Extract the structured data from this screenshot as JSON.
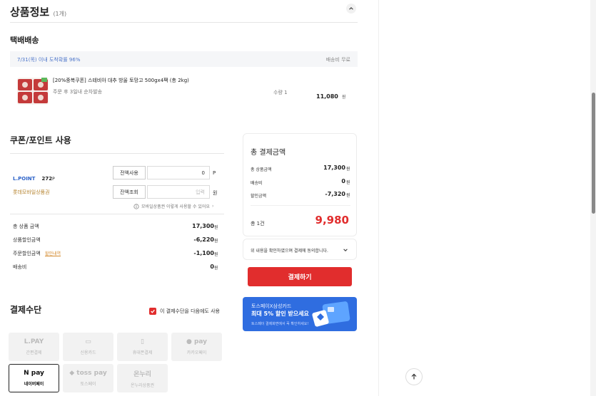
{
  "product_section": {
    "title": "상품정보",
    "count": "(1개)"
  },
  "delivery": {
    "title": "택배배송",
    "arrival": "7/31(목) 이내 도착확률 96%",
    "shipping_fee": "배송비 무료"
  },
  "product": {
    "name": "[20%중복쿠폰] 스테비아 대추 방울 토망고 500gx4팩 (총 2kg)",
    "note": "주문 후 3일내 순차발송",
    "qty": "수량 1",
    "price": "11,080",
    "unit": "원"
  },
  "coupon_section": {
    "title": "쿠폰/포인트 사용",
    "lpoint_brand": "L.POINT",
    "lpoint_value": "272",
    "lpoint_unit": "P",
    "lpoint_button": "전액사용",
    "lpoint_input_value": "0",
    "lpoint_input_unit": "P",
    "voucher_label": "롯데모바일상품권",
    "voucher_button": "잔액조회",
    "voucher_input_placeholder": "입력",
    "voucher_input_unit": "원",
    "notice": "모바일상품권 이렇게 사용할 수 있어요"
  },
  "left_totals": {
    "rows": [
      {
        "label": "총 상품 금액",
        "value": "17,300",
        "unit": "원"
      },
      {
        "label": "상품할인금액",
        "value": "-6,220",
        "unit": "원"
      },
      {
        "label": "주문할인금액",
        "value": "-1,100",
        "unit": "원"
      },
      {
        "label": "배송비",
        "value": "0",
        "unit": "원"
      }
    ],
    "detail_link": "할인내역"
  },
  "payment_method": {
    "title": "결제수단",
    "remember_label": "이 결제수단을 다음에도 사용",
    "tiles": [
      {
        "brand": "L.PAY",
        "name": "간편결제"
      },
      {
        "brand": "▭",
        "name": "신용카드"
      },
      {
        "brand": "▯",
        "name": "휴대폰결제"
      },
      {
        "brand": "● pay",
        "name": "카카오페이"
      },
      {
        "brand": "N pay",
        "name": "네이버페이"
      },
      {
        "brand": "◆ toss pay",
        "name": "토스페이"
      },
      {
        "brand": "온누리",
        "name": "온누리상품권"
      }
    ]
  },
  "summary": {
    "title": "총 결제금액",
    "rows": [
      {
        "label": "총 상품금액",
        "value": "17,300",
        "unit": "원"
      },
      {
        "label": "배송비",
        "value": "0",
        "unit": "원"
      },
      {
        "label": "할인금액",
        "value": "-7,320",
        "unit": "원"
      }
    ],
    "count_label": "총 1건",
    "total": "9,980"
  },
  "agree": {
    "text": "위 내용을 확인하였으며 결제에 동의합니다."
  },
  "pay_button": "결제하기",
  "promo": {
    "line1": "토스페이X삼성카드",
    "line2": "최대 5% 할인 받으세요",
    "line3": "토스페이 결제화면에서 꼭 확인하세요!"
  },
  "colors": {
    "accent": "#e12d2d",
    "link_blue": "#4a73c9",
    "promo_blue": "#2f6de0"
  }
}
